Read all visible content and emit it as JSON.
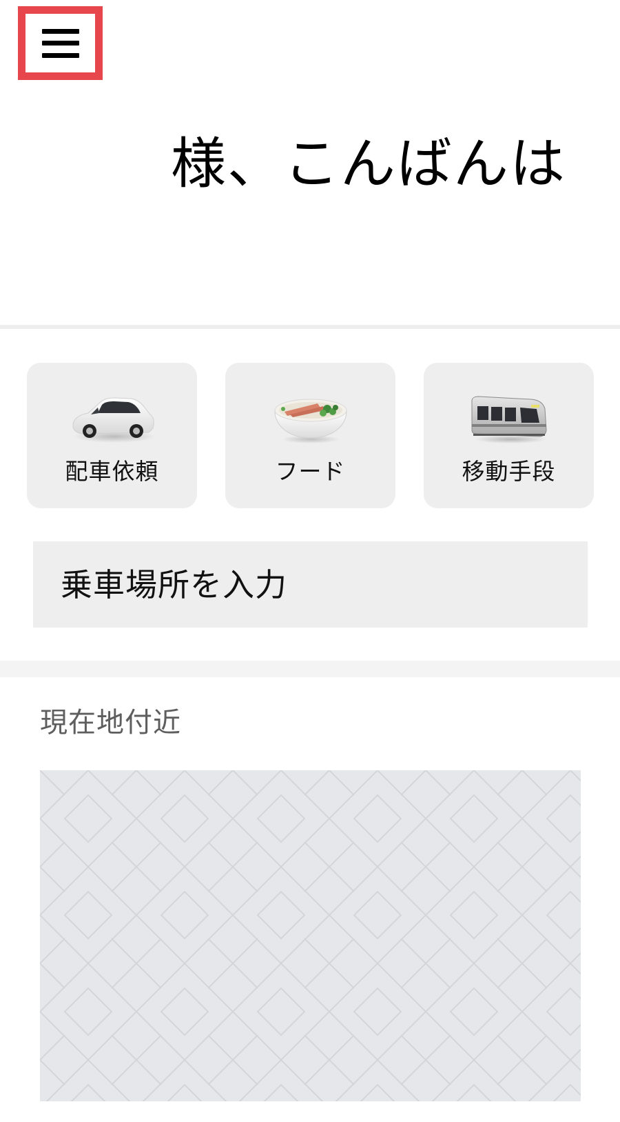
{
  "header": {
    "menu_icon": "hamburger-menu-icon",
    "accent_color": "#e8464d"
  },
  "greeting": {
    "text": "様、こんばんは"
  },
  "services": [
    {
      "label": "配車依頼",
      "icon": "car-icon"
    },
    {
      "label": "フード",
      "icon": "food-bowl-icon"
    },
    {
      "label": "移動手段",
      "icon": "train-icon"
    }
  ],
  "pickup": {
    "placeholder": "乗車場所を入力"
  },
  "nearby": {
    "title": "現在地付近"
  }
}
